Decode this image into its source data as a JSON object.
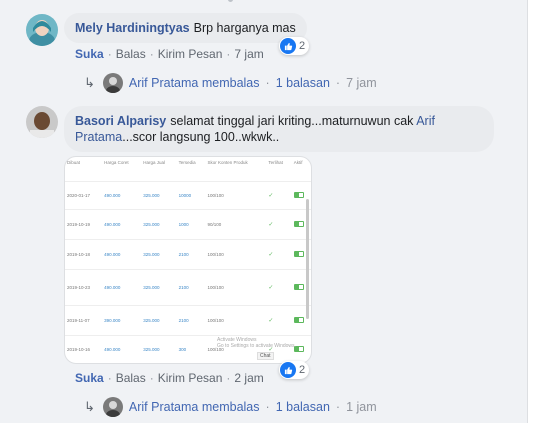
{
  "comments": [
    {
      "author": "Mely Hardiningtyas",
      "text": "Brp harganya mas",
      "actions": {
        "like": "Suka",
        "reply": "Balas",
        "message": "Kirim Pesan",
        "time": "7 jam"
      },
      "reaction_count": "2",
      "reply_summary": {
        "name": "Arif Pratama membalas",
        "count": "1 balasan",
        "time": "7 jam"
      }
    },
    {
      "author": "Basori Alparisy",
      "text_part1": "selamat tinggal jari kriting...maturnuwun cak",
      "mention": "Arif Pratama",
      "text_part2": "...scor langsung 100..wkwk..",
      "actions": {
        "like": "Suka",
        "reply": "Balas",
        "message": "Kirim Pesan",
        "time": "2 jam"
      },
      "reaction_count": "2",
      "reply_summary": {
        "name": "Arif Pratama membalas",
        "count": "1 balasan",
        "time": "1 jam"
      }
    }
  ],
  "attachment": {
    "headers": [
      "Dibuat",
      "Harga Coret",
      "Harga Jual",
      "Tersedia",
      "Skor Konten Produk",
      "Terlihat",
      "Aktif"
    ],
    "rows": [
      [
        "2020-01-17",
        "490.000",
        "325.000",
        "10000",
        "100/100"
      ],
      [
        "2019-10-19",
        "490.000",
        "325.000",
        "1000",
        "90/100"
      ],
      [
        "2019-10-18",
        "490.000",
        "325.000",
        "2100",
        "100/100"
      ],
      [
        "2019-10-23",
        "490.000",
        "325.000",
        "2100",
        "100/100"
      ],
      [
        "2019-11-07",
        "390.000",
        "325.000",
        "2100",
        "100/100"
      ],
      [
        "2019-10-16",
        "490.000",
        "325.000",
        "300",
        "100/100"
      ]
    ],
    "watermark_line1": "Activate Windows",
    "watermark_line2": "Go to Settings to activate Windows.",
    "chat_label": "Chat"
  },
  "icons": {
    "like": "thumbs-up-icon",
    "reply_arrow": "reply-arrow-icon"
  },
  "colors": {
    "link": "#385898",
    "bubble": "#e9ebee",
    "like_blue": "#1877f2"
  }
}
